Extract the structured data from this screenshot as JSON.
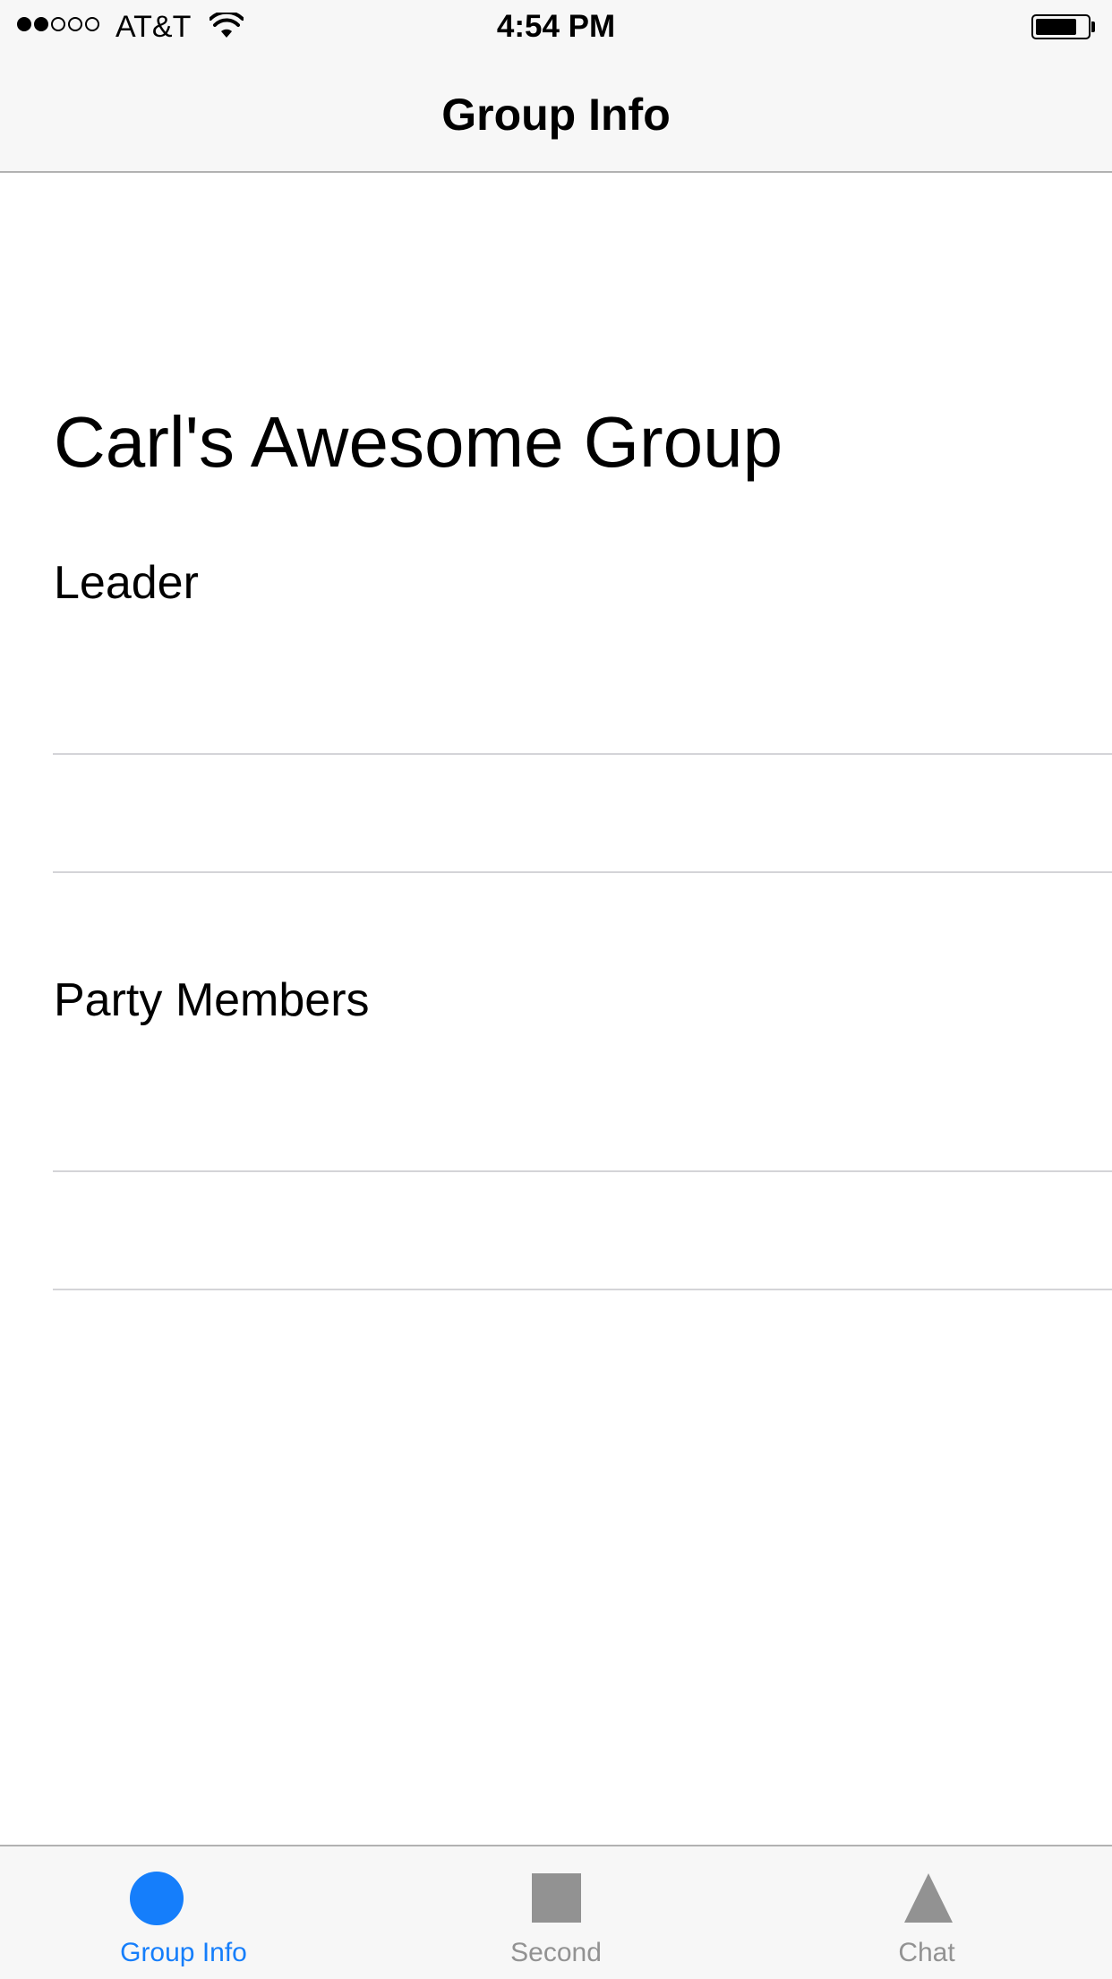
{
  "status_bar": {
    "carrier": "AT&T",
    "time": "4:54 PM",
    "signal_bars_filled": 2,
    "signal_bars_total": 5,
    "battery_level": 0.8
  },
  "nav_bar": {
    "title": "Group Info"
  },
  "content": {
    "group_name": "Carl's Awesome Group",
    "sections": [
      {
        "label": "Leader"
      },
      {
        "label": "Party Members"
      }
    ]
  },
  "tab_bar": {
    "tabs": [
      {
        "label": "Group Info",
        "icon": "circle-icon",
        "selected": true
      },
      {
        "label": "Second",
        "icon": "square-icon",
        "selected": false
      },
      {
        "label": "Chat",
        "icon": "triangle-icon",
        "selected": false
      }
    ]
  },
  "colors": {
    "accent": "#157efb",
    "inactive": "#929292",
    "bar_background": "#f7f7f7",
    "separator": "#d4d4d8"
  }
}
